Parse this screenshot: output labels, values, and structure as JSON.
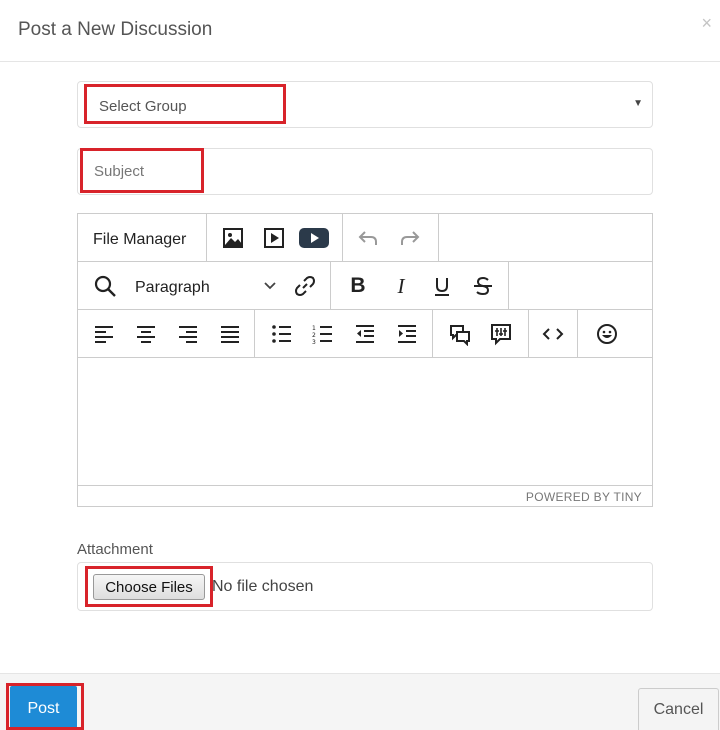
{
  "modal": {
    "title": "Post a New Discussion",
    "close_icon": "close-icon",
    "close_glyph": "×"
  },
  "form": {
    "group_select": {
      "selected": "Select Group",
      "caret": "▼"
    },
    "subject": {
      "placeholder": "Subject",
      "value": ""
    },
    "editor": {
      "file_manager_label": "File Manager",
      "block_format": "Paragraph",
      "powered_by": "POWERED BY TINY",
      "toolbar_row1": [
        "image-icon",
        "media-icon",
        "youtube-icon",
        "undo-icon",
        "redo-icon"
      ],
      "toolbar_row2": [
        "search-icon",
        "format-dropdown-chevron-icon",
        "link-icon",
        "bold-icon",
        "italic-icon",
        "underline-icon",
        "strikethrough-icon"
      ],
      "toolbar_row3": [
        "align-left-icon",
        "align-center-icon",
        "align-right-icon",
        "align-justify-icon",
        "bullet-list-icon",
        "numbered-list-icon",
        "outdent-icon",
        "indent-icon",
        "comments-icon",
        "edit-comments-icon",
        "source-code-icon",
        "emoticons-icon"
      ]
    },
    "attachment": {
      "label": "Attachment",
      "button_label": "Choose Files",
      "status": "No file chosen"
    }
  },
  "footer": {
    "post_label": "Post",
    "cancel_label": "Cancel"
  },
  "colors": {
    "primary": "#1e8bd6",
    "highlight": "#d8232a",
    "youtube_icon": "#2b3a4a"
  }
}
